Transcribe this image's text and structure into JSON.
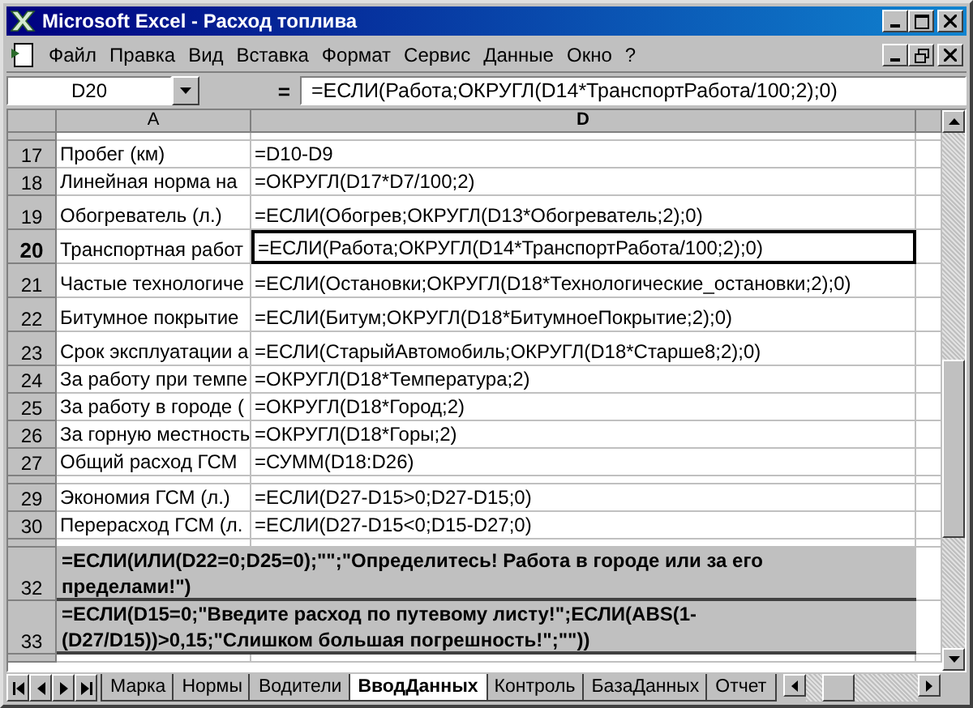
{
  "window": {
    "title": "Microsoft Excel - Расход топлива"
  },
  "menu": [
    {
      "label": "Файл"
    },
    {
      "label": "Правка"
    },
    {
      "label": "Вид"
    },
    {
      "label": "Вставка"
    },
    {
      "label": "Формат"
    },
    {
      "label": "Сервис"
    },
    {
      "label": "Данные"
    },
    {
      "label": "Окно"
    },
    {
      "label": "?"
    }
  ],
  "formula_bar": {
    "name_box": "D20",
    "equals": "=",
    "formula": "=ЕСЛИ(Работа;ОКРУГЛ(D14*ТранспортРабота/100;2);0)"
  },
  "columns": [
    {
      "label": "A",
      "selected": false
    },
    {
      "label": "D",
      "selected": true
    }
  ],
  "rows": [
    {
      "kind": "partial"
    },
    {
      "kind": "normal",
      "number": "17",
      "col_a": "Пробег (км)",
      "col_d": "=D10-D9",
      "selected": false
    },
    {
      "kind": "normal",
      "number": "18",
      "col_a": "Линейная норма на",
      "col_d": "=ОКРУГЛ(D17*D7/100;2)",
      "selected": false
    },
    {
      "kind": "tall",
      "number": "19",
      "col_a": "Обогреватель (л.)",
      "col_d": "=ЕСЛИ(Обогрев;ОКРУГЛ(D13*Обогреватель;2);0)",
      "selected": false
    },
    {
      "kind": "tall",
      "number": "20",
      "col_a": "Транспортная работ",
      "col_d": "=ЕСЛИ(Работа;ОКРУГЛ(D14*ТранспортРабота/100;2);0)",
      "selected": true
    },
    {
      "kind": "tall",
      "number": "21",
      "col_a": "Частые технологиче",
      "col_d": "=ЕСЛИ(Остановки;ОКРУГЛ(D18*Технологические_остановки;2);0)",
      "selected": false
    },
    {
      "kind": "tall",
      "number": "22",
      "col_a": "Битумное покрытие",
      "col_d": "=ЕСЛИ(Битум;ОКРУГЛ(D18*БитумноеПокрытие;2);0)",
      "selected": false
    },
    {
      "kind": "tall",
      "number": "23",
      "col_a": "Срок эксплуатации а",
      "col_d": "=ЕСЛИ(СтарыйАвтомобиль;ОКРУГЛ(D18*Старше8;2);0)",
      "selected": false
    },
    {
      "kind": "normal",
      "number": "24",
      "col_a": "За работу при темпе",
      "col_d": "=ОКРУГЛ(D18*Температура;2)",
      "selected": false
    },
    {
      "kind": "normal",
      "number": "25",
      "col_a": "За работу в городе (",
      "col_d": "=ОКРУГЛ(D18*Город;2)",
      "selected": false
    },
    {
      "kind": "normal",
      "number": "26",
      "col_a": "За горную местность",
      "col_d": "=ОКРУГЛ(D18*Горы;2)",
      "selected": false
    },
    {
      "kind": "normal",
      "number": "27",
      "col_a": "Общий расход ГСМ",
      "col_d": "=СУММ(D18:D26)",
      "selected": false
    },
    {
      "kind": "hidden"
    },
    {
      "kind": "normal",
      "number": "29",
      "col_a": "Экономия ГСМ (л.)",
      "col_d": "=ЕСЛИ(D27-D15>0;D27-D15;0)",
      "selected": false
    },
    {
      "kind": "normal",
      "number": "30",
      "col_a": "Перерасход ГСМ (л.",
      "col_d": "=ЕСЛИ(D27-D15<0;D15-D27;0)",
      "selected": false
    },
    {
      "kind": "hidden"
    },
    {
      "kind": "note",
      "number": "32",
      "note": "=ЕСЛИ(ИЛИ(D22=0;D25=0);\"\";\"Определитесь! Работа в городе или за его пределами!\")",
      "selected": false
    },
    {
      "kind": "note",
      "number": "33",
      "note": "=ЕСЛИ(D15=0;\"Введите расход по путевому листу!\";ЕСЛИ(ABS(1-(D27/D15))>0,15;\"Слишком большая погрешность!\";\"\"))",
      "selected": false
    },
    {
      "kind": "partial"
    }
  ],
  "sheet_tabs": [
    {
      "label": "Марка",
      "selected": false
    },
    {
      "label": "Нормы",
      "selected": false
    },
    {
      "label": "Водители",
      "selected": false
    },
    {
      "label": "ВводДанных",
      "selected": true
    },
    {
      "label": "Контроль",
      "selected": false
    },
    {
      "label": "БазаДанных",
      "selected": false
    },
    {
      "label": "Отчет",
      "selected": false
    }
  ]
}
